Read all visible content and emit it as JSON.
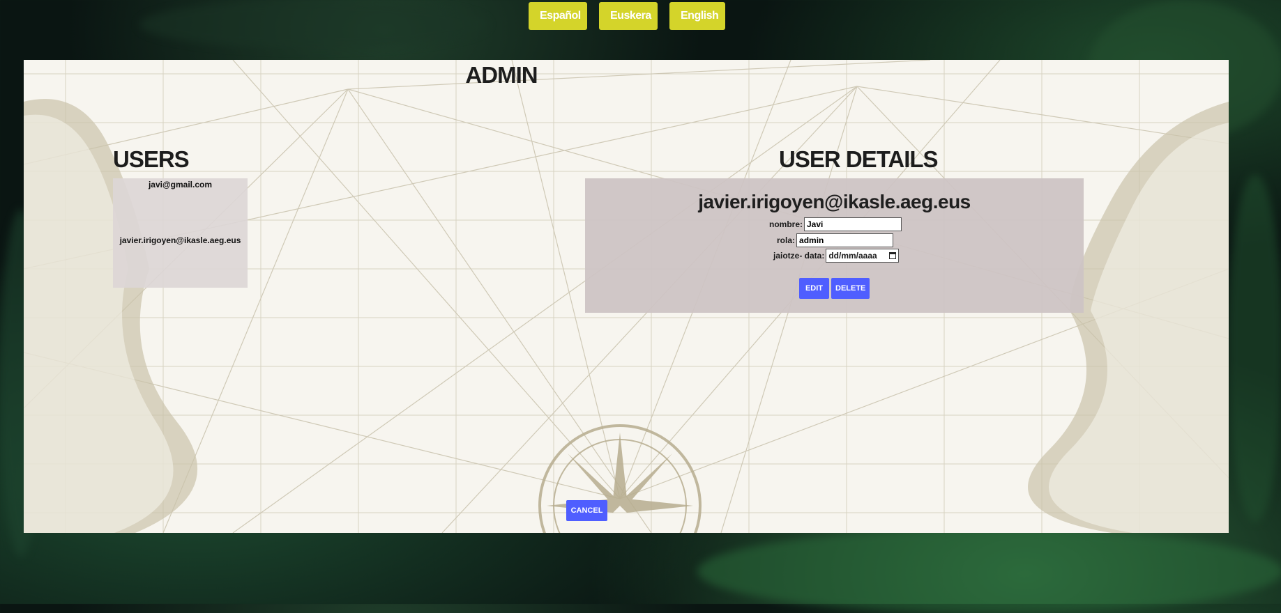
{
  "languages": {
    "es": "Español",
    "eu": "Euskera",
    "en": "English"
  },
  "admin": {
    "title": "ADMIN",
    "users_title": "USERS",
    "users": [
      "javi@gmail.com",
      "javier.irigoyen@ikasle.aeg.eus"
    ],
    "details_title": "USER DETAILS",
    "details": {
      "email": "javier.irigoyen@ikasle.aeg.eus",
      "nombre_label": "nombre:",
      "nombre_value": "Javi",
      "rola_label": "rola:",
      "rola_value": "admin",
      "jaiotze_label": "jaiotze- data:",
      "jaiotze_placeholder": "dd/mm/aaaa",
      "edit_label": "EDIT",
      "delete_label": "DELETE"
    },
    "cancel_label": "CANCEL"
  },
  "colors": {
    "lang_button": "#d4d42a",
    "action_button": "#4f5eff",
    "panel_box": "#cdc4c4"
  }
}
